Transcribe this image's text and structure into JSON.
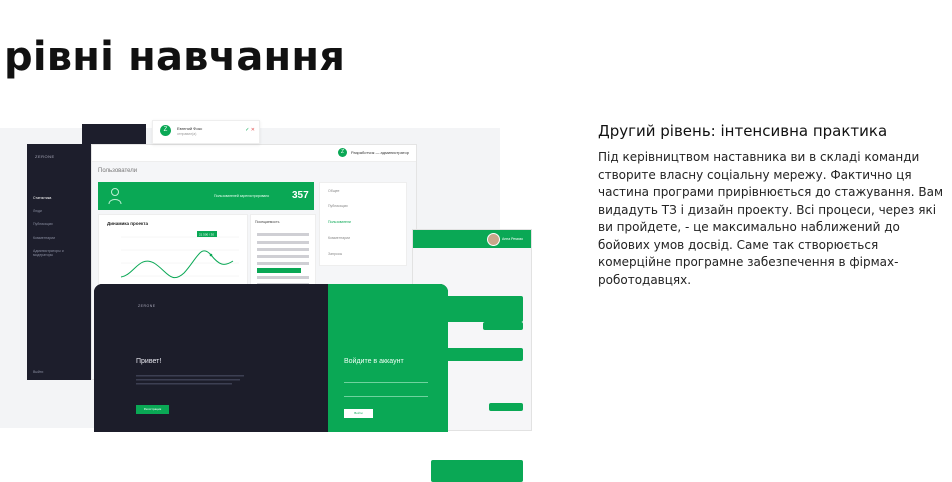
{
  "page": {
    "heading": "рівні навчання"
  },
  "info": {
    "title": "Другий рівень: інтенсивна практика",
    "body": "Під керівництвом наставника ви в складі команди створите власну соціальну мережу. Фактично ця частина програми прирівнюється до стажування. Вам видадуть ТЗ і дизайн проекту. Всі процеси, через які ви пройдете, - це максимально наближений до бойових умов досвід. Саме так створюється комерційне програмне забезпечення в фірмах-роботодавцях."
  },
  "mockup": {
    "notification": {
      "avatar_letter": "Z",
      "name": "Евгений Фокс",
      "subtitle": "отправил(а)"
    },
    "sidebar": {
      "logo": "ZERONE",
      "items": [
        "Статистика",
        "Люди",
        "Публикации",
        "Комментарии",
        "Администраторы и модераторы"
      ],
      "footer": "Выйти"
    },
    "admin": {
      "avatar_letter": "Z",
      "role": "Разработчик — администратор",
      "page_title": "Пользователи",
      "banner_label": "Пользователей зарегистрировано",
      "banner_count": "357",
      "chart_title": "Динамика проекта",
      "chart_tooltip": "21 500 / 30",
      "calendar_title": "Посещаемость",
      "menu_items": [
        "Общее",
        "Публикации",
        "Пользователи",
        "Комментарии",
        "Запросы"
      ]
    },
    "chat": {
      "user_name": "Анна Ремизо"
    },
    "laptop": {
      "brand": "ZERONE",
      "greeting": "Привет!",
      "left_button": "Регистрация",
      "login_title": "Войдите в аккаунт",
      "login_button": "Войти"
    },
    "colors": {
      "accent": "#0aa855",
      "dark": "#1c1d2a"
    }
  }
}
